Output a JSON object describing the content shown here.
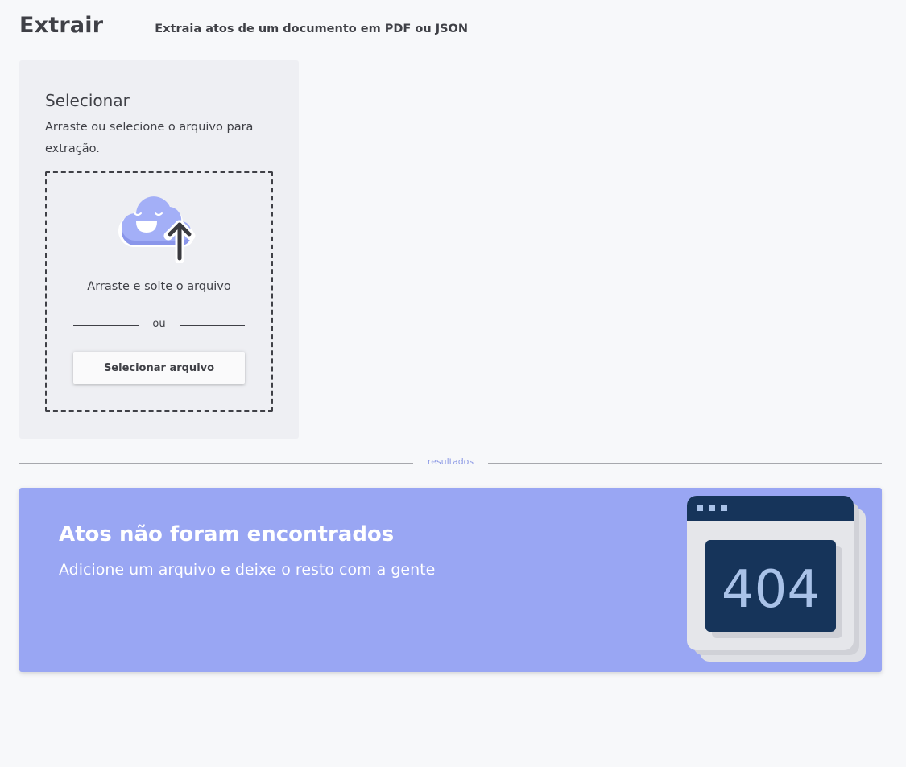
{
  "header": {
    "title": "Extrair",
    "subtitle": "Extraia atos de um documento em PDF ou JSON"
  },
  "upload": {
    "title": "Selecionar",
    "description": "Arraste ou selecione o arquivo para extração.",
    "drop_text": "Arraste e solte o arquivo",
    "divider_text": "ou",
    "button_label": "Selecionar arquivo",
    "cloud_icon": "cloud-upload-icon"
  },
  "results": {
    "separator_label": "resultados"
  },
  "empty_state": {
    "title": "Atos não foram encontrados",
    "description": "Adicione um arquivo e deixe o resto com a gente",
    "error_code": "404",
    "illustration_icon": "browser-404-icon"
  },
  "colors": {
    "background": "#f7f8fa",
    "card": "#eeeff3",
    "text": "#3f4046",
    "accent": "#99a6f3",
    "accent_label": "#8d9ae5",
    "navy": "#16345a"
  }
}
